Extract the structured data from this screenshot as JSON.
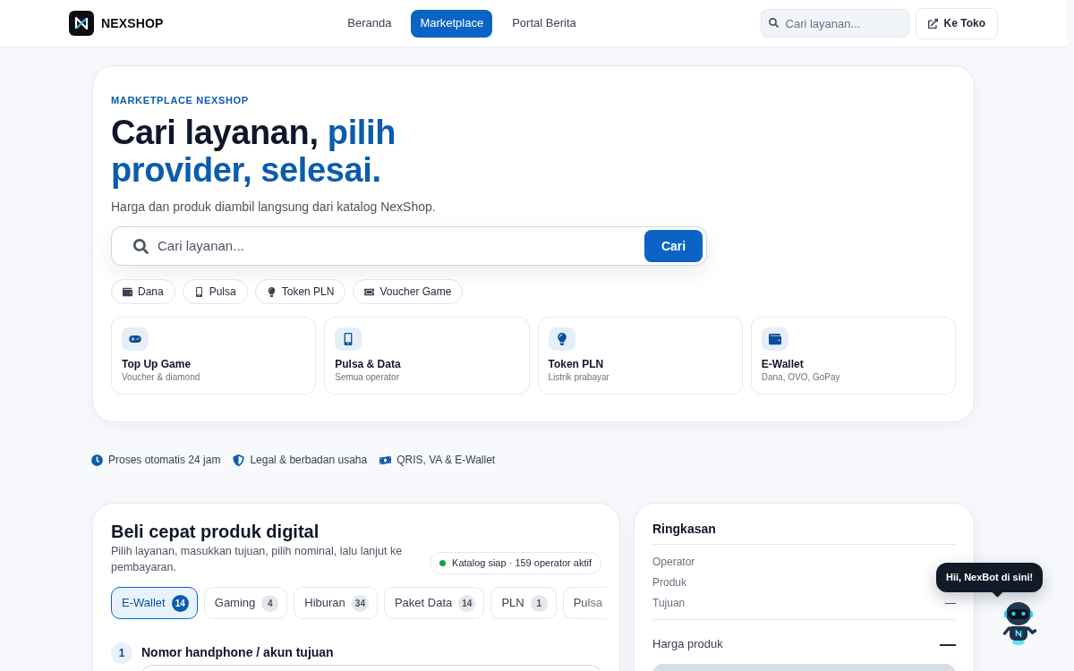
{
  "header": {
    "brand": "NEXSHOP",
    "nav": [
      {
        "label": "Beranda",
        "selected": false
      },
      {
        "label": "Marketplace",
        "selected": true
      },
      {
        "label": "Portal Berita",
        "selected": false
      }
    ],
    "search": {
      "placeholder": "Cari layanan..."
    },
    "store_button": "Ke Toko"
  },
  "hero": {
    "eyebrow": "MARKETPLACE NEXSHOP",
    "title": "Cari layanan,",
    "title_accent": "pilih provider, selesai.",
    "subtitle": "Harga dan produk diambil langsung dari katalog NexShop.",
    "search": {
      "placeholder": "Cari layanan...",
      "button": "Cari"
    },
    "quick_chips": [
      {
        "kind": "wallet",
        "label": "Dana"
      },
      {
        "kind": "phone",
        "label": "Pulsa"
      },
      {
        "kind": "electricity",
        "label": "Token PLN"
      },
      {
        "kind": "game_voucher",
        "label": "Voucher Game"
      }
    ],
    "categories": [
      {
        "kind": "game",
        "title": "Top Up Game",
        "subtitle": "Voucher & diamond"
      },
      {
        "kind": "phone",
        "title": "Pulsa & Data",
        "subtitle": "Semua operator"
      },
      {
        "kind": "electricity",
        "title": "Token PLN",
        "subtitle": "Listrik prabayar"
      },
      {
        "kind": "wallet",
        "title": "E-Wallet",
        "subtitle": "Dana, OVO, GoPay"
      }
    ]
  },
  "trust_badges": [
    {
      "kind": "speed",
      "label": "Proses otomatis 24 jam"
    },
    {
      "kind": "legal",
      "label": "Legal & berbadan usaha"
    },
    {
      "kind": "payment",
      "label": "QRIS, VA & E-Wallet"
    }
  ],
  "quick_buy": {
    "title": "Beli cepat produk digital",
    "description": "Pilih layanan, masukkan tujuan, pilih nominal, lalu lanjut ke pembayaran.",
    "status": {
      "label": "Katalog siap · 159 operator aktif",
      "color": "#16a34a"
    },
    "tabs": [
      {
        "label": "E-Wallet",
        "count": "14",
        "selected": true
      },
      {
        "label": "Gaming",
        "count": "4",
        "selected": false
      },
      {
        "label": "Hiburan",
        "count": "34",
        "selected": false
      },
      {
        "label": "Paket Data",
        "count": "14",
        "selected": false
      },
      {
        "label": "PLN",
        "count": "1",
        "selected": false
      },
      {
        "label": "Pulsa",
        "selected": false
      }
    ],
    "steps": [
      {
        "number": "1",
        "label": "Nomor handphone / akun tujuan"
      }
    ]
  },
  "summary": {
    "title": "Ringkasan",
    "rows": [
      {
        "label": "Operator"
      },
      {
        "label": "Produk"
      },
      {
        "label": "Tujuan",
        "value": "—"
      }
    ],
    "price": {
      "label": "Harga produk",
      "value": "—"
    }
  },
  "chatbot": {
    "greeting": "Hii, NexBot di sini!"
  }
}
